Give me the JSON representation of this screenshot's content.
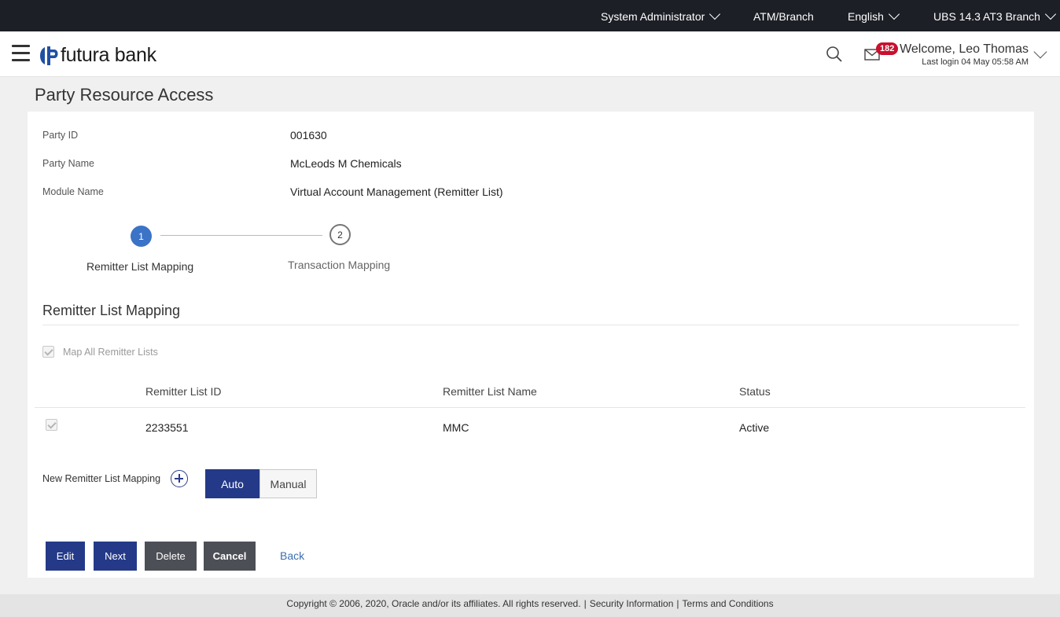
{
  "topbar": {
    "role": "System Administrator",
    "location": "ATM/Branch",
    "language": "English",
    "branch": "UBS 14.3 AT3 Branch"
  },
  "header": {
    "brand": "futura bank",
    "notification_count": "182",
    "welcome": "Welcome, Leo Thomas",
    "last_login": "Last login 04 May 05:58 AM"
  },
  "page": {
    "title": "Party Resource Access"
  },
  "party": {
    "fields": [
      {
        "label": "Party ID",
        "value": "001630"
      },
      {
        "label": "Party Name",
        "value": "McLeods M Chemicals"
      },
      {
        "label": "Module Name",
        "value": "Virtual Account Management (Remitter List)"
      }
    ]
  },
  "stepper": {
    "steps": [
      {
        "number": "1",
        "label": "Remitter List Mapping",
        "active": true
      },
      {
        "number": "2",
        "label": "Transaction Mapping",
        "active": false
      }
    ]
  },
  "section": {
    "title": "Remitter List Mapping",
    "map_all_label": "Map All Remitter Lists"
  },
  "table": {
    "columns": [
      "Remitter List ID",
      "Remitter List Name",
      "Status"
    ],
    "rows": [
      {
        "id": "2233551",
        "name": "MMC",
        "status": "Active"
      }
    ]
  },
  "new_mapping": {
    "label": "New Remitter List Mapping",
    "options": [
      "Auto",
      "Manual"
    ],
    "selected": "Auto"
  },
  "actions": {
    "edit": "Edit",
    "next": "Next",
    "delete": "Delete",
    "cancel": "Cancel",
    "back": "Back"
  },
  "footer": {
    "copyright": "Copyright © 2006, 2020, Oracle and/or its affiliates. All rights reserved.",
    "security": "Security Information",
    "terms": "Terms and Conditions"
  },
  "colors": {
    "primary": "#243a88",
    "step_active": "#3b73c7",
    "badge": "#c8102e",
    "topbar": "#1c1f26"
  }
}
